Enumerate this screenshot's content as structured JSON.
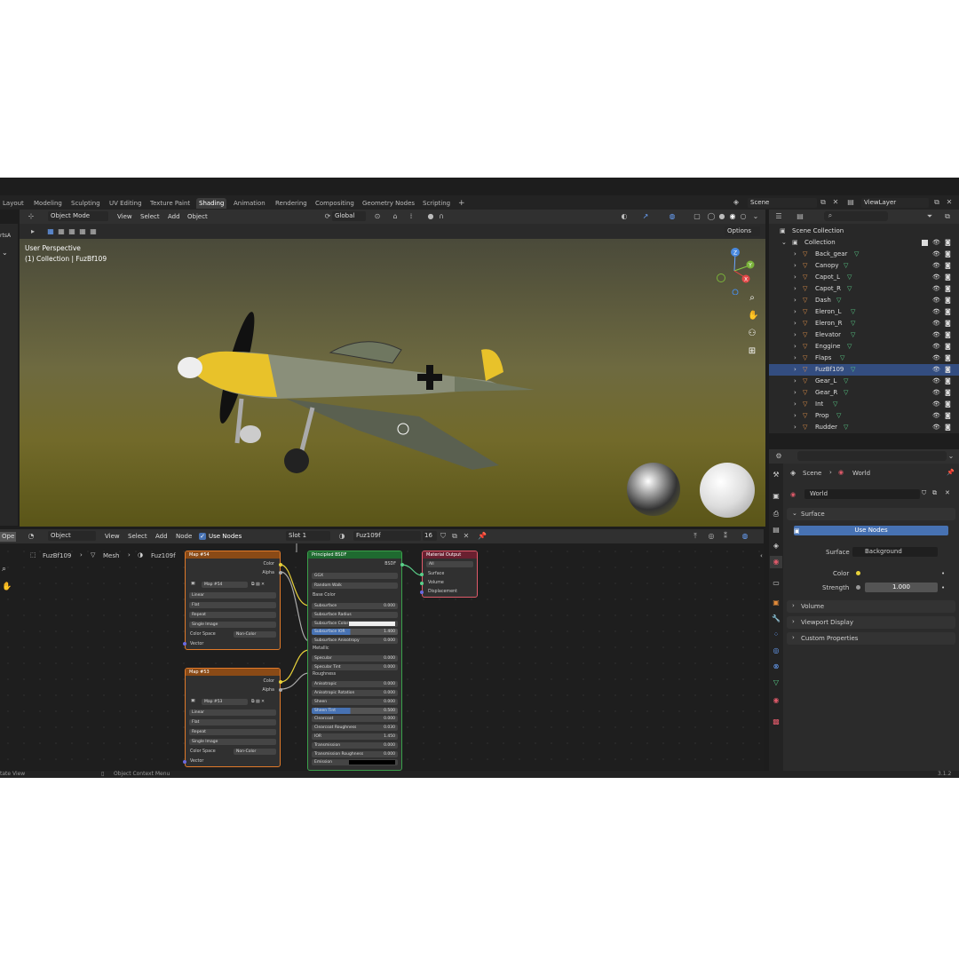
{
  "window": {
    "minimize": "—",
    "restore": "❐",
    "close": "✕"
  },
  "workspace_tabs": [
    "Layout",
    "Modeling",
    "Sculpting",
    "UV Editing",
    "Texture Paint",
    "Shading",
    "Animation",
    "Rendering",
    "Compositing",
    "Geometry Nodes",
    "Scripting"
  ],
  "active_tab": "Shading",
  "add_tab": "+",
  "scene": {
    "name": "Scene",
    "view_layer": "ViewLayer"
  },
  "viewport": {
    "mode": "Object Mode",
    "menus": [
      "View",
      "Select",
      "Add",
      "Object"
    ],
    "transform": "Global",
    "options": "Options",
    "perspective": "User Perspective",
    "collection_info": "(1) Collection | FuzBf109",
    "axes": {
      "x": "X",
      "y": "Y",
      "z": "Z"
    }
  },
  "outliner": {
    "root": "Scene Collection",
    "collection": "Collection",
    "items": [
      "Back_gear",
      "Canopy",
      "Capot_L",
      "Capot_R",
      "Dash",
      "Eleron_L",
      "Eleron_R",
      "Elevator",
      "Enggine",
      "Flaps",
      "FuzBf109",
      "Gear_L",
      "Gear_R",
      "Int",
      "Prop",
      "Rudder"
    ],
    "selected": "FuzBf109"
  },
  "properties": {
    "breadcrumb": [
      "Scene",
      "World"
    ],
    "world_name": "World",
    "surface_panel": "Surface",
    "use_nodes_btn": "Use Nodes",
    "surface_label": "Surface",
    "surface_value": "Background",
    "color_label": "Color",
    "strength_label": "Strength",
    "strength_value": "1.000",
    "panels": [
      "Volume",
      "Viewport Display",
      "Custom Properties"
    ]
  },
  "node_editor": {
    "editor_type": "Object",
    "menus": [
      "View",
      "Select",
      "Add",
      "Node"
    ],
    "use_nodes": "Use Nodes",
    "slot": "Slot 1",
    "material": "Fuz109f",
    "users": "16",
    "breadcrumb": [
      "FuzBf109",
      "Mesh",
      "Fuz109f"
    ]
  },
  "image_node_1": {
    "title": "Map #54",
    "image": "Map #54",
    "color": "Color",
    "alpha": "Alpha",
    "opts": [
      "Linear",
      "Flat",
      "Repeat",
      "Single Image"
    ],
    "cs_label": "Color Space",
    "cs_value": "Non-Color",
    "vector": "Vector"
  },
  "image_node_2": {
    "title": "Map #53",
    "image": "Map #53",
    "color": "Color",
    "alpha": "Alpha",
    "opts": [
      "Linear",
      "Flat",
      "Repeat",
      "Single Image"
    ],
    "cs_label": "Color Space",
    "cs_value": "Non-Color",
    "vector": "Vector"
  },
  "bsdf": {
    "title": "Principled BSDF",
    "out": "BSDF",
    "dist": "GGX",
    "sss": "Random Walk",
    "base_color": "Base Color",
    "fields": [
      {
        "l": "Subsurface",
        "v": "0.000"
      },
      {
        "l": "Subsurface Radius",
        "v": ""
      },
      {
        "l": "Subsurface Color",
        "v": ""
      },
      {
        "l": "Subsurface IOR",
        "v": "1.400"
      },
      {
        "l": "Subsurface Anisotropy",
        "v": "0.000"
      },
      {
        "l": "Metallic",
        "v": ""
      },
      {
        "l": "Specular",
        "v": "0.000"
      },
      {
        "l": "Specular Tint",
        "v": "0.000"
      },
      {
        "l": "Roughness",
        "v": ""
      },
      {
        "l": "Anisotropic",
        "v": "0.000"
      },
      {
        "l": "Anisotropic Rotation",
        "v": "0.000"
      },
      {
        "l": "Sheen",
        "v": "0.000"
      },
      {
        "l": "Sheen Tint",
        "v": "0.500"
      },
      {
        "l": "Clearcoat",
        "v": "0.000"
      },
      {
        "l": "Clearcoat Roughness",
        "v": "0.030"
      },
      {
        "l": "IOR",
        "v": "1.450"
      },
      {
        "l": "Transmission",
        "v": "0.000"
      },
      {
        "l": "Transmission Roughness",
        "v": "0.000"
      },
      {
        "l": "Emission",
        "v": ""
      }
    ]
  },
  "output_node": {
    "title": "Material Output",
    "target": "All",
    "sockets": [
      "Surface",
      "Volume",
      "Displacement"
    ]
  },
  "status": {
    "left": "tate View",
    "mid": "Object Context Menu",
    "version": "3.1.2"
  },
  "left_partial": {
    "open": "Ope",
    "tab": "rtsA"
  }
}
